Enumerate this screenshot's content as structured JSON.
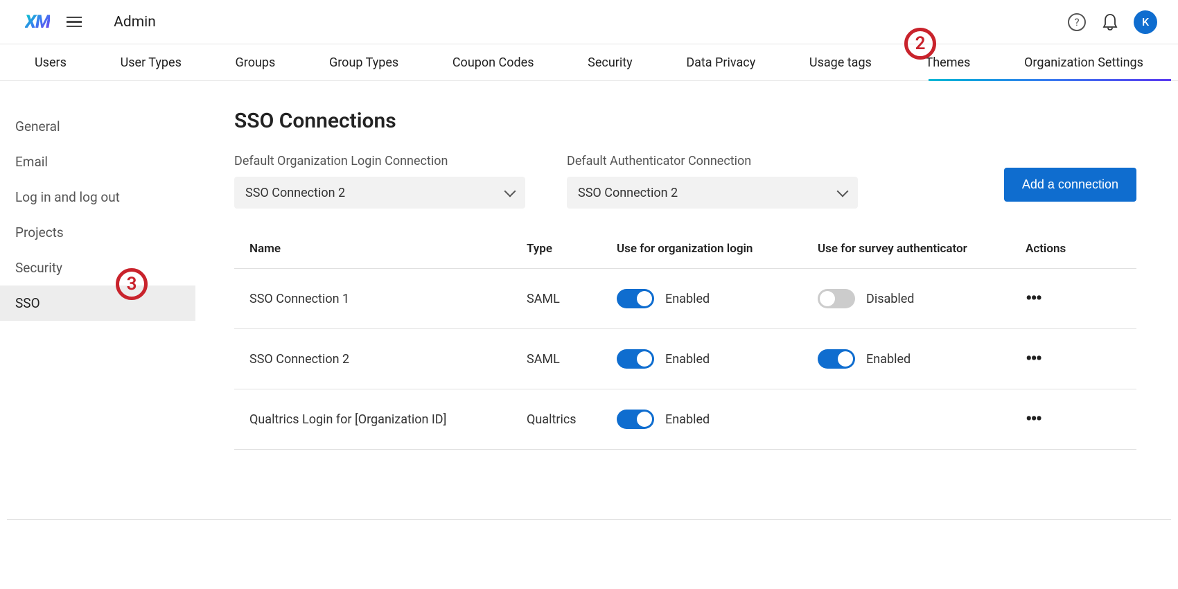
{
  "header": {
    "logo_text": "XM",
    "title": "Admin",
    "avatar_letter": "K"
  },
  "nav": {
    "tabs": [
      {
        "label": "Users"
      },
      {
        "label": "User Types"
      },
      {
        "label": "Groups"
      },
      {
        "label": "Group Types"
      },
      {
        "label": "Coupon Codes"
      },
      {
        "label": "Security"
      },
      {
        "label": "Data Privacy"
      },
      {
        "label": "Usage tags"
      },
      {
        "label": "Themes"
      },
      {
        "label": "Organization Settings",
        "active": true
      }
    ]
  },
  "sidebar": {
    "items": [
      {
        "label": "General"
      },
      {
        "label": "Email"
      },
      {
        "label": "Log in and log out"
      },
      {
        "label": "Projects"
      },
      {
        "label": "Security"
      },
      {
        "label": "SSO",
        "active": true
      }
    ]
  },
  "main": {
    "page_title": "SSO Connections",
    "default_org_login": {
      "label": "Default Organization Login Connection",
      "value": "SSO Connection 2"
    },
    "default_auth": {
      "label": "Default Authenticator Connection",
      "value": "SSO Connection 2"
    },
    "add_btn": "Add a connection",
    "table": {
      "headers": {
        "name": "Name",
        "type": "Type",
        "org_login": "Use for organization login",
        "survey_auth": "Use for survey authenticator",
        "actions": "Actions"
      },
      "status": {
        "enabled": "Enabled",
        "disabled": "Disabled"
      },
      "rows": [
        {
          "name": "SSO Connection 1",
          "type": "SAML",
          "org_on": true,
          "survey_on": false,
          "has_survey": true
        },
        {
          "name": "SSO Connection 2",
          "type": "SAML",
          "org_on": true,
          "survey_on": true,
          "has_survey": true
        },
        {
          "name": "Qualtrics Login for [Organization ID]",
          "type": "Qualtrics",
          "org_on": true,
          "survey_on": null,
          "has_survey": false
        }
      ]
    }
  },
  "annotations": {
    "two": "2",
    "three": "3"
  }
}
